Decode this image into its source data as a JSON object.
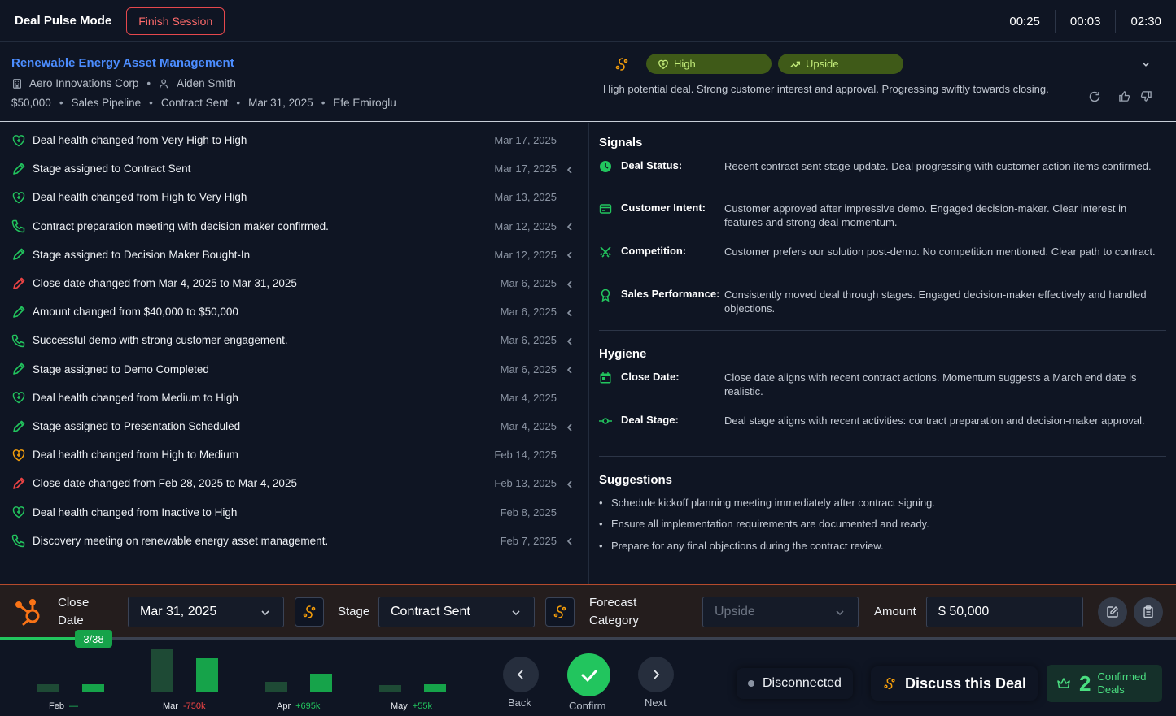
{
  "header": {
    "mode_title": "Deal Pulse Mode",
    "finish_label": "Finish Session",
    "timers": [
      "00:25",
      "00:03",
      "02:30"
    ]
  },
  "deal": {
    "title": "Renewable Energy Asset Management",
    "company": "Aero Innovations Corp",
    "owner": "Aiden Smith",
    "amount": "$50,000",
    "pipeline": "Sales Pipeline",
    "stage": "Contract Sent",
    "close_date": "Mar 31, 2025",
    "contact": "Efe Emiroglu",
    "health_badge": "High",
    "forecast_badge": "Upside",
    "summary": "High potential deal. Strong customer interest and approval. Progressing swiftly towards closing."
  },
  "timeline": [
    {
      "icon": "heart-icon",
      "color": "#22c55e",
      "text": "Deal health changed from Very High to High",
      "date": "Mar 17, 2025",
      "expand": false
    },
    {
      "icon": "pencil-icon",
      "color": "#22c55e",
      "text": "Stage assigned to Contract Sent",
      "date": "Mar 17, 2025",
      "expand": true
    },
    {
      "icon": "heart-icon",
      "color": "#22c55e",
      "text": "Deal health changed from High to Very High",
      "date": "Mar 13, 2025",
      "expand": false
    },
    {
      "icon": "phone-icon",
      "color": "#22c55e",
      "text": "Contract preparation meeting with decision maker confirmed.",
      "date": "Mar 12, 2025",
      "expand": true
    },
    {
      "icon": "pencil-icon",
      "color": "#22c55e",
      "text": "Stage assigned to Decision Maker Bought-In",
      "date": "Mar 12, 2025",
      "expand": true
    },
    {
      "icon": "pencil-icon",
      "color": "#ef4444",
      "text": "Close date changed from Mar 4, 2025 to Mar 31, 2025",
      "date": "Mar 6, 2025",
      "expand": true
    },
    {
      "icon": "pencil-icon",
      "color": "#22c55e",
      "text": "Amount changed from $40,000 to $50,000",
      "date": "Mar 6, 2025",
      "expand": true
    },
    {
      "icon": "phone-icon",
      "color": "#22c55e",
      "text": "Successful demo with strong customer engagement.",
      "date": "Mar 6, 2025",
      "expand": true
    },
    {
      "icon": "pencil-icon",
      "color": "#22c55e",
      "text": "Stage assigned to Demo Completed",
      "date": "Mar 6, 2025",
      "expand": true
    },
    {
      "icon": "heart-icon",
      "color": "#22c55e",
      "text": "Deal health changed from Medium to High",
      "date": "Mar 4, 2025",
      "expand": false
    },
    {
      "icon": "pencil-icon",
      "color": "#22c55e",
      "text": "Stage assigned to Presentation Scheduled",
      "date": "Mar 4, 2025",
      "expand": true
    },
    {
      "icon": "heart-icon",
      "color": "#f59e0b",
      "text": "Deal health changed from High to Medium",
      "date": "Feb 14, 2025",
      "expand": false
    },
    {
      "icon": "pencil-icon",
      "color": "#ef4444",
      "text": "Close date changed from Feb 28, 2025 to Mar 4, 2025",
      "date": "Feb 13, 2025",
      "expand": true
    },
    {
      "icon": "heart-icon",
      "color": "#22c55e",
      "text": "Deal health changed from Inactive to High",
      "date": "Feb 8, 2025",
      "expand": false
    },
    {
      "icon": "phone-icon",
      "color": "#22c55e",
      "text": "Discovery meeting on renewable energy asset management.",
      "date": "Feb 7, 2025",
      "expand": true
    }
  ],
  "signals": {
    "title": "Signals",
    "items": [
      {
        "icon": "clock-icon",
        "label": "Deal Status:",
        "text": "Recent contract sent stage update. Deal progressing with customer action items confirmed."
      },
      {
        "icon": "card-icon",
        "label": "Customer Intent:",
        "text": "Customer approved after impressive demo. Engaged decision-maker. Clear interest in features and strong deal momentum."
      },
      {
        "icon": "swords-icon",
        "label": "Competition:",
        "text": "Customer prefers our solution post-demo. No competition mentioned. Clear path to contract."
      },
      {
        "icon": "award-icon",
        "label": "Sales Performance:",
        "text": "Consistently moved deal through stages. Engaged decision-maker effectively and handled objections."
      }
    ]
  },
  "hygiene": {
    "title": "Hygiene",
    "items": [
      {
        "icon": "calendar-icon",
        "label": "Close Date:",
        "text": "Close date aligns with recent contract actions. Momentum suggests a March end date is realistic."
      },
      {
        "icon": "commit-icon",
        "label": "Deal Stage:",
        "text": "Deal stage aligns with recent activities: contract preparation and decision-maker approval."
      }
    ]
  },
  "suggestions": {
    "title": "Suggestions",
    "items": [
      "Schedule kickoff planning meeting immediately after contract signing.",
      "Ensure all implementation requirements are documented and ready.",
      "Prepare for any final objections during the contract review."
    ]
  },
  "editbar": {
    "close_date_label_1": "Close",
    "close_date_label_2": "Date",
    "close_date_value": "Mar 31, 2025",
    "stage_label": "Stage",
    "stage_value": "Contract Sent",
    "forecast_label_1": "Forecast",
    "forecast_label_2": "Category",
    "forecast_value": "Upside",
    "amount_label": "Amount",
    "amount_value": "$ 50,000"
  },
  "progress": {
    "label": "3/38",
    "fraction": 0.0789
  },
  "chart_data": {
    "type": "bar",
    "categories": [
      "Feb",
      "Mar",
      "Apr",
      "May"
    ],
    "deltas": [
      "—",
      "-750k",
      "+695k",
      "+55k"
    ],
    "delta_colors": [
      "#22c55e",
      "#ef4444",
      "#22c55e",
      "#22c55e"
    ],
    "series": [
      {
        "values": [
          1,
          5.5,
          1.3,
          0.9
        ]
      },
      {
        "values": [
          1,
          4.4,
          2.4,
          1
        ]
      }
    ],
    "ylim": [
      0,
      5.5
    ]
  },
  "nav": {
    "back_label": "Back",
    "confirm_label": "Confirm",
    "next_label": "Next"
  },
  "footer": {
    "connection_status": "Disconnected",
    "discuss_label": "Discuss this Deal",
    "confirmed_count": "2",
    "confirmed_label_1": "Confirmed",
    "confirmed_label_2": "Deals"
  }
}
